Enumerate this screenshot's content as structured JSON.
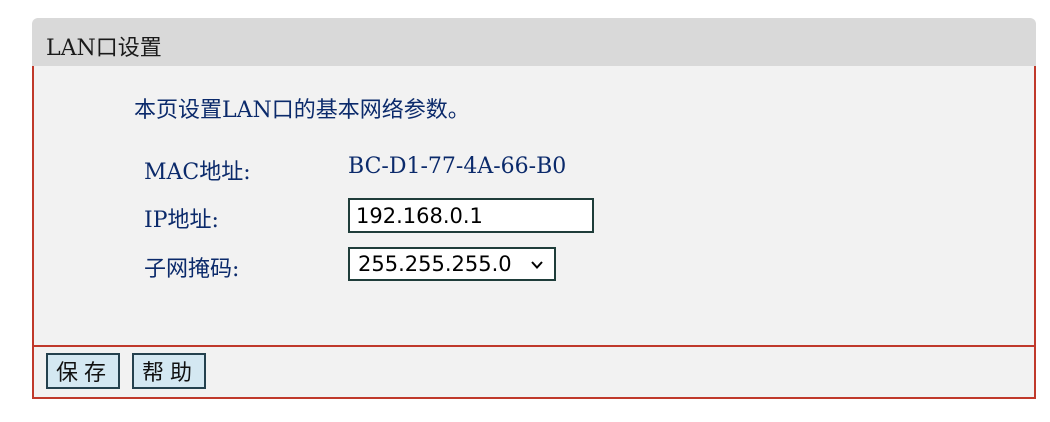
{
  "panel": {
    "title": "LAN口设置"
  },
  "body": {
    "intro": "本页设置LAN口的基本网络参数。",
    "mac": {
      "label": "MAC地址:",
      "value": "BC-D1-77-4A-66-B0"
    },
    "ip": {
      "label": "IP地址:",
      "value": "192.168.0.1"
    },
    "subnet": {
      "label": "子网掩码:",
      "selected": "255.255.255.0",
      "icon": "chevron-down-icon"
    }
  },
  "footer": {
    "save_label": "保存",
    "help_label": "帮助"
  },
  "colors": {
    "header_bg": "#d9d9d9",
    "body_bg": "#f2f2f2",
    "border": "#c0392b",
    "text": "#0b2a6b",
    "button_bg": "#d4e8f2"
  }
}
